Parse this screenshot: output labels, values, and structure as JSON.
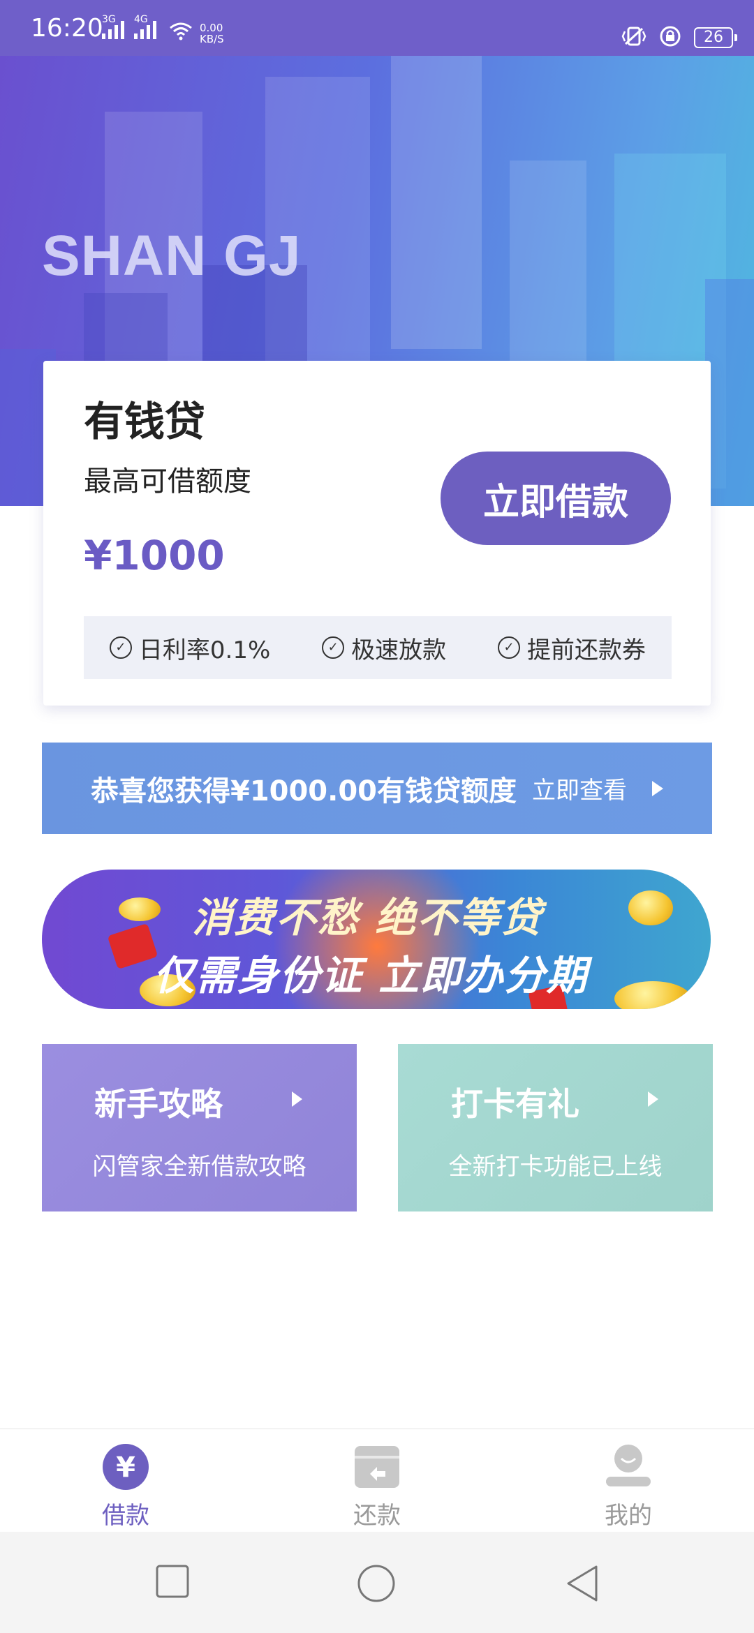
{
  "status_bar": {
    "time": "16:20",
    "signal1": "3G",
    "signal2": "4G",
    "net_speed": "0.00",
    "net_unit": "KB/S",
    "battery": "26"
  },
  "banner": {
    "logo": "SHAN GJ"
  },
  "loan_card": {
    "title": "有钱贷",
    "subtitle": "最高可借额度",
    "amount": "¥1000",
    "button": "立即借款",
    "features": [
      "日利率0.1%",
      "极速放款",
      "提前还款券"
    ]
  },
  "notice": {
    "text": "恭喜您获得¥1000.00有钱贷额度",
    "link": "立即查看"
  },
  "promo": {
    "line1": "消费不愁 绝不等贷",
    "line2": "仅需身份证 立即办分期"
  },
  "tiles": [
    {
      "title": "新手攻略",
      "subtitle": "闪管家全新借款攻略"
    },
    {
      "title": "打卡有礼",
      "subtitle": "全新打卡功能已上线"
    }
  ],
  "tabbar": {
    "items": [
      {
        "label": "借款",
        "icon": "yen-icon",
        "active": true
      },
      {
        "label": "还款",
        "icon": "wallet-icon",
        "active": false
      },
      {
        "label": "我的",
        "icon": "profile-icon",
        "active": false
      }
    ]
  },
  "navbar": {
    "icons": [
      "recents-icon",
      "home-icon",
      "back-icon"
    ]
  },
  "colors": {
    "accent": "#6d5fc0",
    "status_bar": "#6f5fc9",
    "notice": "#6b98e2"
  }
}
